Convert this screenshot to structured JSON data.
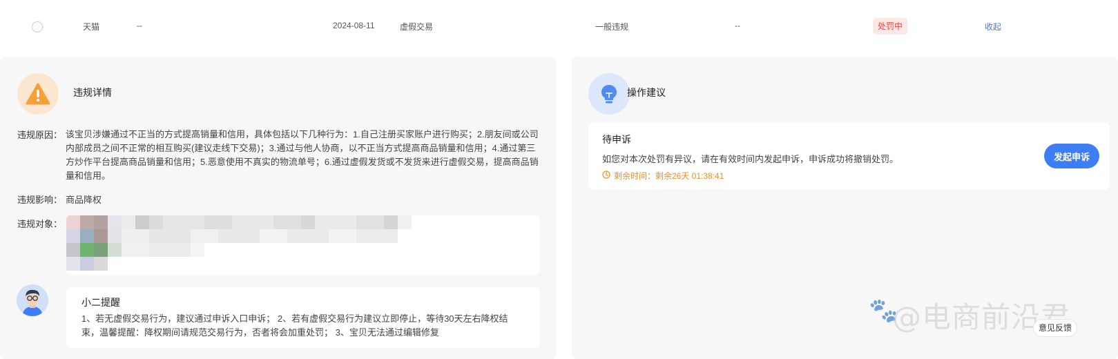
{
  "row": {
    "platform": "天猫",
    "dash1": "--",
    "date": "2024-08-11",
    "violation_type": "虚假交易",
    "level": "一般违规",
    "dash2": "--",
    "status": "处罚中",
    "collapse_label": "收起"
  },
  "details": {
    "title": "违规详情",
    "reason_label": "违规原因：",
    "reason_text": "该宝贝涉嫌通过不正当的方式提高销量和信用，具体包括以下几种行为：1.自己注册买家账户进行购买；2.朋友间或公司内部成员之间不正常的相互购买(建议走线下交易)；3.通过与他人协商，以不正当方式提高商品销量和信用；4.通过第三方炒作平台提高商品销量和信用；5.恶意使用不真实的物流单号；6.通过虚假发货或不发货来进行虚假交易，提高商品销量和信用。",
    "impact_label": "违规影响：",
    "impact_text": "商品降权",
    "target_label": "违规对象："
  },
  "reminder": {
    "title": "小二提醒",
    "text": "1、若无虚假交易行为，建议通过申诉入口申诉； 2、若有虚假交易行为建议立即停止，等待30天左右降权结束，温馨提醒：降权期间请规范交易行为，否者将会加重处罚； 3、宝贝无法通过编辑修复"
  },
  "advice": {
    "title": "操作建议",
    "card_title": "待申诉",
    "card_desc": "如您对本次处罚有异议，请在有效时间内发起申诉，申诉成功将撤销处罚。",
    "timer_text": "剩余时间：剩余26天 01:38:41",
    "appeal_button": "发起申诉"
  },
  "watermark": {
    "text": "@电商前沿君",
    "feedback_label": "意见反馈"
  },
  "colors": {
    "accent": "#3d7ef5",
    "status_red": "#e8473f",
    "timer_orange": "#f08c1b",
    "warning_orange": "#f5a13a"
  },
  "icons": {
    "warning": "warning-icon",
    "bulb": "bulb-icon",
    "clock": "clock-icon",
    "paw": "paw-icon"
  }
}
